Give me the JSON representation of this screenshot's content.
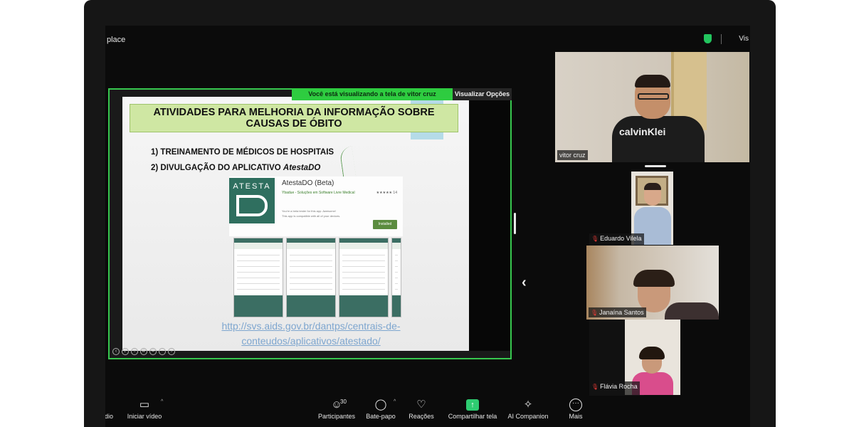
{
  "window": {
    "title_fragment": "place",
    "view_menu_fragment": "Vis"
  },
  "share_notice": {
    "text": "Você está visualizando a tela de  vitor cruz",
    "options_label": "Visualizar Opções"
  },
  "slide": {
    "heading_line1": "ATIVIDADES PARA MELHORIA DA INFORMAÇÃO SOBRE",
    "heading_line2": "CAUSAS DE ÓBITO",
    "bullet1": "1) TREINAMENTO DE MÉDICOS DE HOSPITAIS",
    "bullet2_prefix": "2) DIVULGAÇÃO DO APLICATIVO ",
    "bullet2_app": "AtestaDO",
    "app_logo_text": "ATESTA",
    "app_title": "AtestaDO (Beta)",
    "app_developer": "Ybadue - Soluções em Software Livre   Medical",
    "app_stars": "★★★★★ 14",
    "app_note1": "You're a beta tester for this app. Awesome!",
    "app_note2": "This app is compatible with all of your devices.",
    "install_label": "Installed",
    "link_line1": "http://svs.aids.gov.br/dantps/centrais-de-",
    "link_line2": "conteudos/aplicativos/atestado/"
  },
  "participants": [
    {
      "name": "vitor cruz",
      "muted": false
    },
    {
      "name": "Eduardo Vilela",
      "muted": true
    },
    {
      "name": "Janaína Santos",
      "muted": true
    },
    {
      "name": "Flávia Rocha",
      "muted": true
    }
  ],
  "presenter_shirt_text": "calvinKlei",
  "toolbar": {
    "audio_fragment": "dio",
    "video_label": "Iniciar vídeo",
    "participants_label": "Participantes",
    "participants_count": "30",
    "chat_label": "Bate-papo",
    "reactions_label": "Reações",
    "share_label": "Compartilhar tela",
    "ai_label": "AI Companion",
    "more_label": "Mais"
  },
  "colors": {
    "share_green": "#2ecc40",
    "slide_heading_bg": "#cfe7a3",
    "app_green": "#2f6f5f",
    "muted_red": "#e53935"
  }
}
